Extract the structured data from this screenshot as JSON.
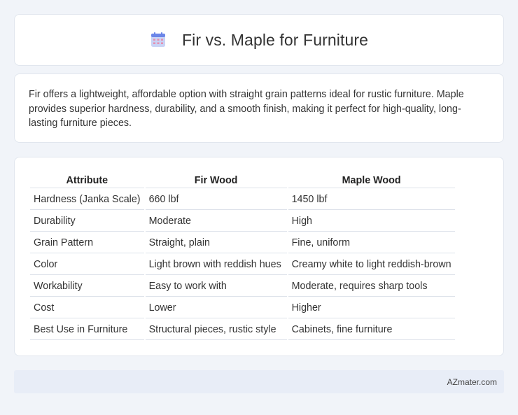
{
  "header": {
    "title": "Fir vs. Maple for Furniture",
    "icon": "calendar-icon",
    "icon_colors": {
      "body": "#c9d3f5",
      "top": "#6b86e8",
      "grid": "#e58fb0"
    }
  },
  "summary": {
    "text": "Fir offers a lightweight, affordable option with straight grain patterns ideal for rustic furniture. Maple provides superior hardness, durability, and a smooth finish, making it perfect for high-quality, long-lasting furniture pieces."
  },
  "table": {
    "headers": [
      "Attribute",
      "Fir Wood",
      "Maple Wood"
    ],
    "rows": [
      [
        "Hardness (Janka Scale)",
        "660 lbf",
        "1450 lbf"
      ],
      [
        "Durability",
        "Moderate",
        "High"
      ],
      [
        "Grain Pattern",
        "Straight, plain",
        "Fine, uniform"
      ],
      [
        "Color",
        "Light brown with reddish hues",
        "Creamy white to light reddish-brown"
      ],
      [
        "Workability",
        "Easy to work with",
        "Moderate, requires sharp tools"
      ],
      [
        "Cost",
        "Lower",
        "Higher"
      ],
      [
        "Best Use in Furniture",
        "Structural pieces, rustic style",
        "Cabinets, fine furniture"
      ]
    ]
  },
  "footer": {
    "text": "AZmater.com"
  }
}
